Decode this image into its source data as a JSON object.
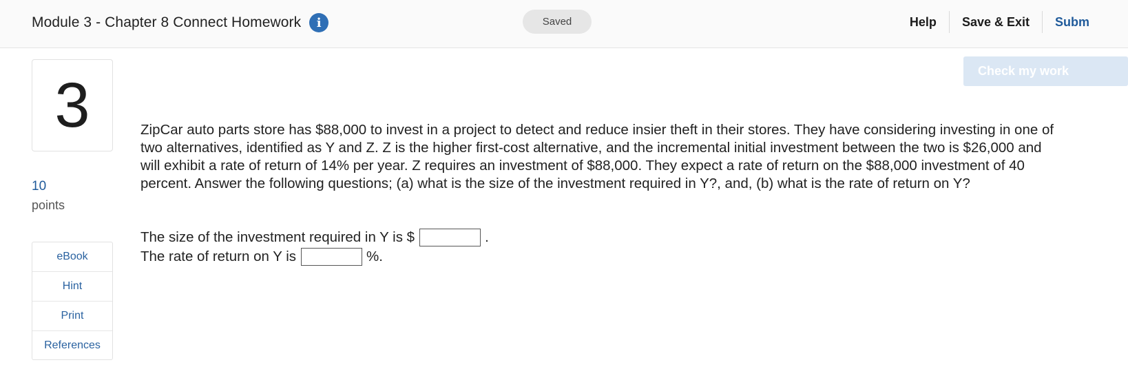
{
  "header": {
    "title": "Module 3 - Chapter 8 Connect Homework",
    "info_icon_glyph": "i",
    "status": "Saved",
    "nav": {
      "help": "Help",
      "save_exit": "Save & Exit",
      "submit": "Subm"
    }
  },
  "question": {
    "number": "3",
    "points_value": "10",
    "points_label": "points",
    "text": "ZipCar auto parts store has $88,000 to invest in a project to detect and reduce insier theft in their stores. They have considering investing in one of two alternatives, identified as Y and Z. Z is the higher first-cost alternative, and the incremental initial investment between the two is $26,000 and will exhibit a rate of return of 14% per year. Z requires an investment of $88,000. They expect a rate of return on the $88,000 investment of 40 percent. Answer the following questions; (a) what is the size of the investment required in Y?, and, (b) what is the rate of return on Y?",
    "answers": [
      {
        "prefix": "The size of the investment required in Y is $",
        "value": "",
        "suffix": "."
      },
      {
        "prefix": "The rate of return on Y is",
        "value": "",
        "suffix": "%."
      }
    ]
  },
  "tools": [
    "eBook",
    "Hint",
    "Print",
    "References"
  ],
  "check_my_work": "Check my work",
  "colors": {
    "accent": "#2f6fb5",
    "link": "#2a62a0",
    "check_button_bg": "#dbe7f4"
  }
}
